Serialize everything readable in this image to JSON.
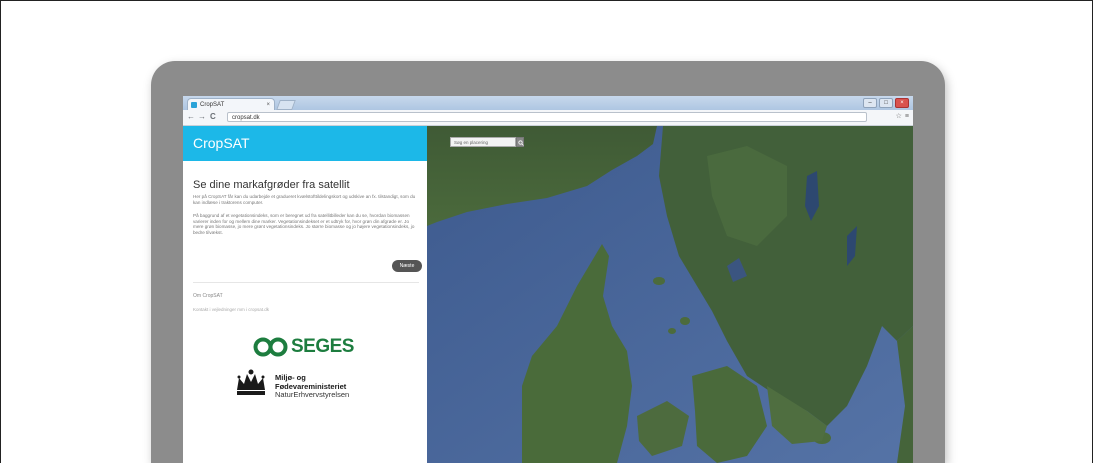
{
  "browser": {
    "tab_title": "CropSAT",
    "tab_close": "×",
    "url": "cropsat.dk",
    "window_buttons": [
      "–",
      "□",
      "×"
    ],
    "nav": {
      "back": "←",
      "forward": "→",
      "reload": "C"
    },
    "right_icons": [
      "☆",
      "≡"
    ]
  },
  "panel": {
    "brand": "CropSAT",
    "headline": "Se dine markafgrøder fra satellit",
    "paragraph1": "Her på CropSAT får kan du udarbejde et gradueret kvælstofttildelingskort og udskive an fx. tilstandigt, som du kan indlæse i traktorens computer.",
    "paragraph2": "På baggrund af et vegetationsindeks, som er beregnet ud fra satellitbilleder kan du se, hvordan biomassen varierer inden for og mellem dine marker. Vegetationsindekset er et udtryk for, hvor grøn din afgrøde er. Jo mere grøn biomasse, jo mere grønt vegetationsindeks. Jo større biomasse og jo højere vegetationsindeks, jo bedre tilvækst.",
    "more_button": "Næste",
    "about_link": "Om CropSAT",
    "contact_text": "Kontakt i vejledninger mm i cropsat.dk",
    "logo_seges": "SEGES",
    "ministry_line1": "Miljø- og",
    "ministry_line2": "Fødevareministeriet",
    "ministry_line3": "NaturErhvervstyrelsen"
  },
  "map": {
    "search_placeholder": "Søg en placering"
  },
  "colors": {
    "brand": "#1cb8e8",
    "seges_green": "#1d7d3f",
    "laptop_bezel": "#8c8c8c",
    "sea": "#4a6598"
  }
}
